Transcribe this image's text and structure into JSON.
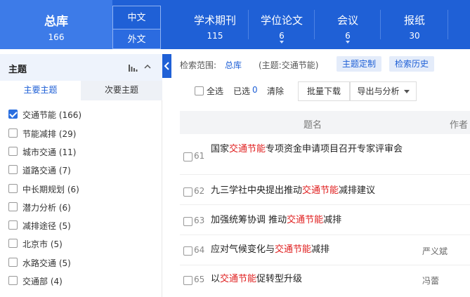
{
  "nav": {
    "total": {
      "label": "总库",
      "count": "166"
    },
    "lang_zh": "中文",
    "lang_en": "外文",
    "tabs": [
      {
        "label": "学术期刊",
        "count": "115",
        "has_dropdown": false
      },
      {
        "label": "学位论文",
        "count": "6",
        "has_dropdown": true
      },
      {
        "label": "会议",
        "count": "6",
        "has_dropdown": true
      },
      {
        "label": "报纸",
        "count": "30",
        "has_dropdown": false
      }
    ]
  },
  "sidebar": {
    "title": "主题",
    "tab_primary": "主要主题",
    "tab_secondary": "次要主题",
    "facets": [
      {
        "label": "交通节能 (166)",
        "checked": true
      },
      {
        "label": "节能减排 (29)",
        "checked": false
      },
      {
        "label": "城市交通 (11)",
        "checked": false
      },
      {
        "label": "道路交通 (7)",
        "checked": false
      },
      {
        "label": "中长期规划 (6)",
        "checked": false
      },
      {
        "label": "潜力分析 (6)",
        "checked": false
      },
      {
        "label": "减排途径 (5)",
        "checked": false
      },
      {
        "label": "北京市 (5)",
        "checked": false
      },
      {
        "label": "水路交通 (5)",
        "checked": false
      },
      {
        "label": "交通部 (4)",
        "checked": false
      }
    ]
  },
  "search": {
    "scope_label": "检索范围:",
    "scope_db": "总库",
    "scope_topic": "(主题:交通节能)",
    "custom_topic": "主题定制",
    "history": "检索历史"
  },
  "toolbar": {
    "select_all": "全选",
    "selected_label": "已选",
    "selected_count": "0",
    "clear": "清除",
    "batch_download": "批量下载",
    "export": "导出与分析"
  },
  "table": {
    "col_title": "题名",
    "col_author": "作者",
    "highlight_color": "#e02020",
    "rows": [
      {
        "num": "61",
        "pre": "国家",
        "hl": "交通节能",
        "post": "专项资金申请项目召开专家评审会",
        "author": ""
      },
      {
        "num": "62",
        "pre": "九三学社中央提出推动",
        "hl": "交通节能",
        "post": "减排建议",
        "author": ""
      },
      {
        "num": "63",
        "pre": "加强统筹协调 推动",
        "hl": "交通节能",
        "post": "减排",
        "author": ""
      },
      {
        "num": "64",
        "pre": "应对气候变化与",
        "hl": "交通节能",
        "post": "减排",
        "author": "严义斌"
      },
      {
        "num": "65",
        "pre": "以",
        "hl": "交通节能",
        "post": "促转型升级",
        "author": "冯蕾"
      }
    ]
  }
}
